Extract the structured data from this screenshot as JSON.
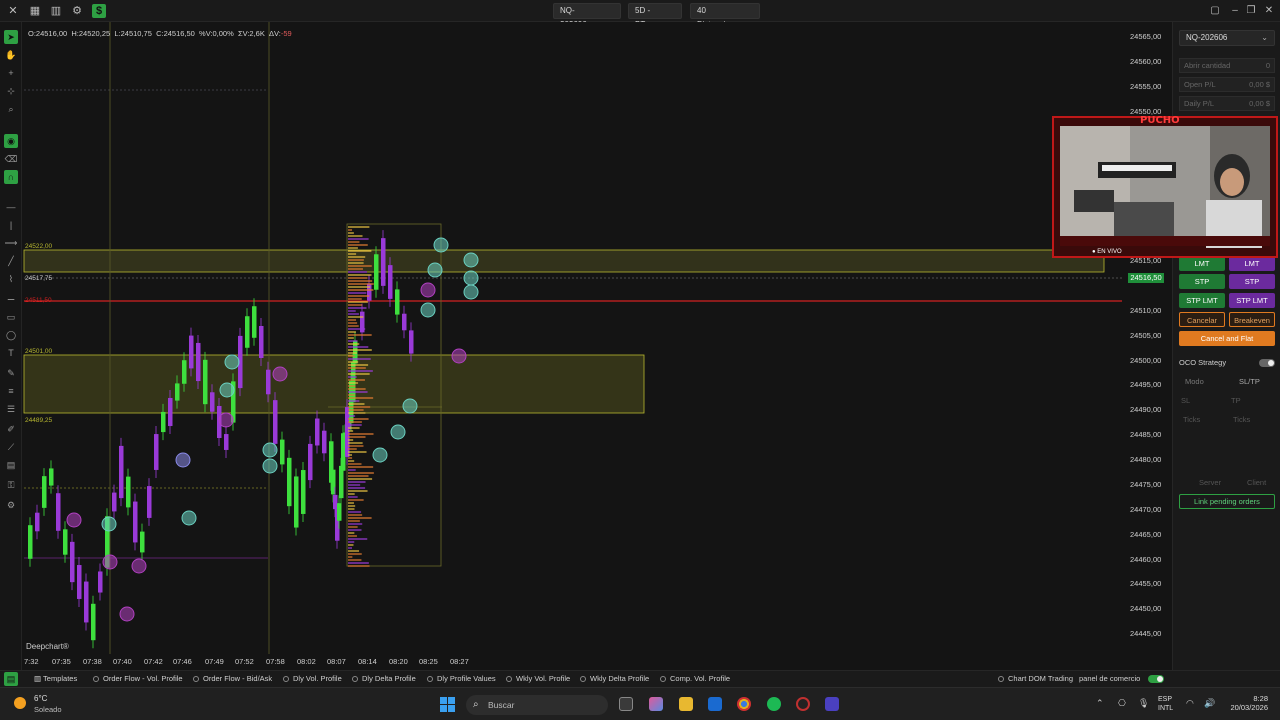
{
  "topbar": {
    "symbol": "NQ-202606",
    "timeframe": "5D - BT",
    "distance": "40 Distancia"
  },
  "ohlc": {
    "open": "O:24516,00",
    "high": "H:24520,25",
    "low": "L:24510,75",
    "close": "C:24516,50",
    "pct": "%V:0,00%",
    "sumvol": "ΣV:2,6K",
    "delta_label": "ΔV:",
    "delta_value": "-59"
  },
  "chart": {
    "watermark": "Deepchart®",
    "level_labels": [
      "24522,00",
      "24517,75",
      "24511,50",
      "24501,00",
      "24489,25"
    ],
    "current_price": "24516,50",
    "price_ticks": [
      "24565,00",
      "24560,00",
      "24555,00",
      "24550,00",
      "24515,00",
      "24510,00",
      "24505,00",
      "24500,00",
      "24495,00",
      "24490,00",
      "24485,00",
      "24480,00",
      "24475,00",
      "24470,00",
      "24465,00",
      "24460,00",
      "24455,00",
      "24450,00",
      "24445,00"
    ],
    "time_ticks": [
      "7:32",
      "07:35",
      "07:38",
      "07:40",
      "07:42",
      "07:46",
      "07:49",
      "07:52",
      "07:58",
      "08:02",
      "08:07",
      "08:14",
      "08:20",
      "08:25",
      "08:27"
    ]
  },
  "rightpanel": {
    "symbol": "NQ-202606",
    "qty_label": "Abrir cantidad",
    "qty_value": "0",
    "openpl_label": "Open P/L",
    "openpl_value": "0,00 $",
    "dailypl_label": "Daily P/L",
    "dailypl_value": "0,00 $",
    "lmt": "LMT",
    "stp": "STP",
    "stplmt": "STP LMT",
    "cancel": "Cancelar",
    "breakeven": "Breakeven",
    "cancel_flat": "Cancel and Flat",
    "oco_label": "OCO Strategy",
    "mode_label": "Modo",
    "mode_value": "SL/TP",
    "sl": "SL",
    "tp": "TP",
    "ticks": "Ticks",
    "server": "Server",
    "client": "Client",
    "link_pending": "Link pending orders"
  },
  "webcam": {
    "title": "PUCHO",
    "live": "● EN VIVO"
  },
  "bottombar": {
    "templates": "Templates",
    "tabs": [
      "Order Flow - Vol. Profile",
      "Order Flow - Bid/Ask",
      "Dly Vol. Profile",
      "Dly Delta Profile",
      "Dly Profile Values",
      "Wkly Vol. Profile",
      "Wkly Delta Profile",
      "Comp. Vol. Profile"
    ],
    "chart_dom": "Chart DOM Trading",
    "panel": "panel de comercio"
  },
  "taskbar": {
    "temp": "6°C",
    "weather": "Soleado",
    "search_placeholder": "Buscar",
    "lang1": "ESP",
    "lang2": "INTL",
    "time": "8:28",
    "date": "20/03/2026"
  }
}
